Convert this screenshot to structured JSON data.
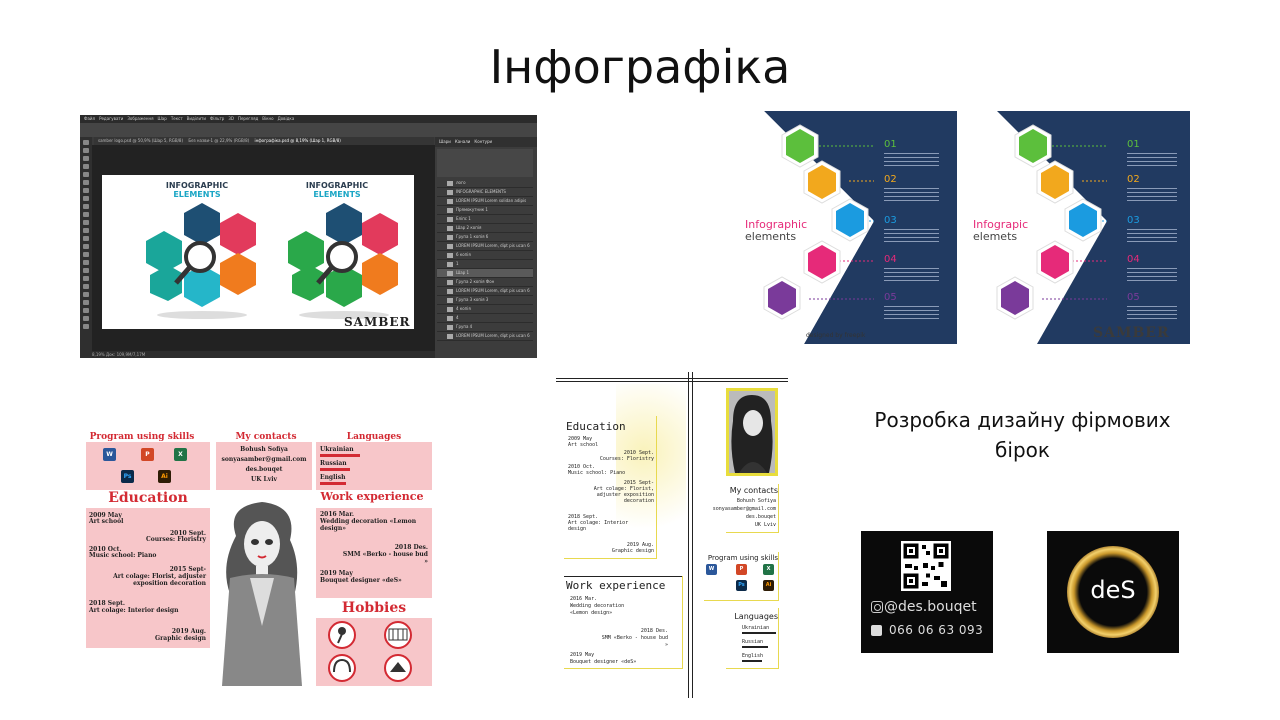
{
  "slide": {
    "title": "Інфографіка",
    "brand_caption": "Розробка дизайну фірмових бірок"
  },
  "photoshop": {
    "menu": [
      "Файл",
      "Редагувати",
      "Зображення",
      "Шар",
      "Текст",
      "Виділити",
      "Фільтр",
      "3D",
      "Перегляд",
      "Вікно",
      "Довідка"
    ],
    "tabs": [
      "samber logo.psd @ 50,9% (Шар 5, RGB/8)",
      "Без назви-1 @ 22,9% (RGB/8)",
      "інфографіка.psd @ 8,19% (Шар 1, RGB/8)"
    ],
    "panel_tabs": [
      "Шари",
      "Канали",
      "Контури"
    ],
    "layers": [
      "лого",
      "INFOGRAPHIC ELEMENTS",
      "LOREM IPSUM Lorem solidan adipis",
      "Прямокутник 1",
      "Еліпс 1",
      "Шар 2 копія",
      "Група 1 копія 6",
      "LOREM IPSUM Lorem, dipt pis ucan 6",
      "6 копія",
      "1",
      "Шар 1",
      "Група 2 копія Фон",
      "LOREM IPSUM Lorem, dipt pis ucan 6",
      "Група 3 копія 3",
      "4 копія",
      "4",
      "Група 4",
      "LOREM IPSUM Lorem, dipt pis ucan 6"
    ],
    "status": "8,19%   Док: 109,9M/7,17M",
    "canvas": {
      "heading1": "INFOGRAPHIC",
      "heading2": "ELEMENTS",
      "watermark": "SAMBER"
    }
  },
  "infographic": {
    "titles": [
      [
        "Infographic",
        "elements"
      ],
      [
        "Infograpic",
        "elemets"
      ]
    ],
    "numbers": [
      "01",
      "02",
      "03",
      "04",
      "05"
    ],
    "colors": [
      "#5cbf3c",
      "#f2a81d",
      "#1b9be0",
      "#e62a79",
      "#7a3a9a"
    ],
    "credit": "designed by  freepik",
    "watermark": "SAMBER"
  },
  "resume_pink": {
    "skills_title": "Program using skills",
    "contacts_title": "My contacts",
    "contacts": [
      "Bohush Sofiya",
      "sonyasamber@gmail.com",
      "des.bouqet",
      "UK Lviv"
    ],
    "languages_title": "Languages",
    "languages": [
      "Ukrainian",
      "Russian",
      "English"
    ],
    "apps": [
      "W",
      "P",
      "X",
      "Ps",
      "Ai"
    ],
    "education_title": "Education",
    "education": [
      [
        "2009 May",
        "Art school"
      ],
      [
        "2010 Sept.",
        "Courses: Floristry"
      ],
      [
        "2010 Oct.",
        "Music school: Piano"
      ],
      [
        "2015 Sept-",
        "Art colage: Florist, adjuster",
        "exposition decoration"
      ],
      [
        "2018 Sept.",
        "Art colage: Interior design"
      ],
      [
        "2019 Aug.",
        "Graphic design"
      ]
    ],
    "work_title": "Work experience",
    "work": [
      [
        "2016 Mar.",
        "Wedding decoration «Lemon",
        "design»"
      ],
      [
        "2018 Des.",
        "SMM «Berko - house bud",
        "»"
      ],
      [
        "2019 May",
        "Bouquet designer «deS»"
      ]
    ],
    "hobbies_title": "Hobbies"
  },
  "resume_white": {
    "education_title": "Education",
    "education": [
      [
        "2009 May",
        "Art school"
      ],
      [
        "2010 Sept.",
        "Courses: Floristry"
      ],
      [
        "2010 Oct.",
        "Music school: Piano"
      ],
      [
        "2015 Sept-",
        "Art colage: Florist,",
        "adjuster exposition",
        "decoration"
      ],
      [
        "2018 Sept.",
        "Art colage: Interior",
        "design"
      ],
      [
        "2019 Aug.",
        "Graphic design"
      ]
    ],
    "work_title": "Work experience",
    "work": [
      [
        "2016 Mar.",
        "Wedding decoration",
        "«Lemon design»"
      ],
      [
        "2018 Des.",
        "SMM «Berko - house bud",
        "»"
      ],
      [
        "2019 May",
        "Bouquet designer «deS»"
      ]
    ],
    "contacts_title": "My contacts",
    "contacts": [
      "Bohush Sofiya",
      "sonyasamber@gmail.com",
      "des.bouqet",
      "UK Lviv"
    ],
    "skills_title": "Program using skills",
    "apps": [
      "W",
      "P",
      "X",
      "Ps",
      "Ai"
    ],
    "languages_title": "Languages",
    "languages": [
      "Ukrainian",
      "Russian",
      "English"
    ]
  },
  "tags": {
    "instagram": "@des.bouqet",
    "phone": "066 06 63 093",
    "logo": "deS"
  }
}
